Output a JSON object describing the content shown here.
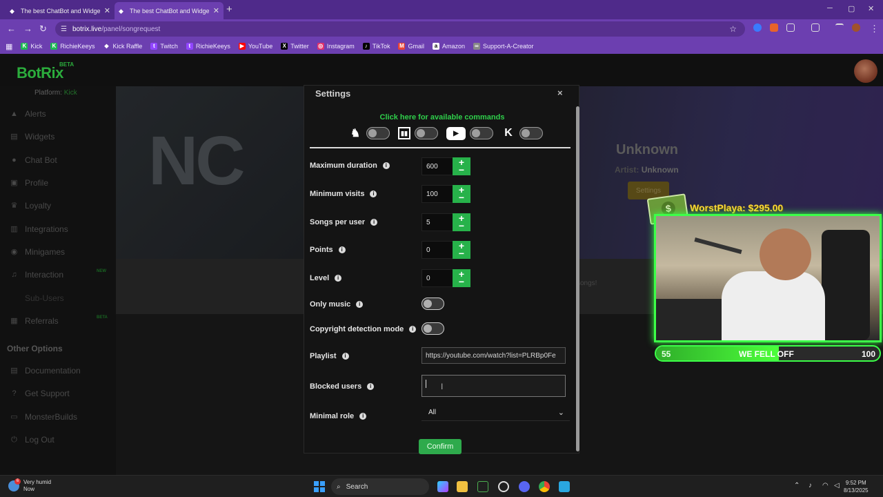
{
  "browser": {
    "tabs": [
      {
        "title": "The best ChatBot and Widgets",
        "active": false
      },
      {
        "title": "The best ChatBot and Widgets",
        "active": true
      }
    ],
    "url_host": "botrix.live",
    "url_path": "/panel/songrequest",
    "bookmarks": [
      {
        "label": "Kick",
        "icon": "kick-icon",
        "color": "#1db954"
      },
      {
        "label": "RichieKeeys",
        "icon": "kick-icon",
        "color": "#1db954"
      },
      {
        "label": "Kick Raffle",
        "icon": "diamond-icon",
        "color": "#ffffff"
      },
      {
        "label": "Twitch",
        "icon": "twitch-icon",
        "color": "#9146ff"
      },
      {
        "label": "RichieKeeys",
        "icon": "twitch-icon",
        "color": "#9146ff"
      },
      {
        "label": "YouTube",
        "icon": "youtube-icon",
        "color": "#ff0000"
      },
      {
        "label": "Twitter",
        "icon": "x-icon",
        "color": "#000000"
      },
      {
        "label": "Instagram",
        "icon": "instagram-icon",
        "color": "#e1306c"
      },
      {
        "label": "TikTok",
        "icon": "tiktok-icon",
        "color": "#000000"
      },
      {
        "label": "Gmail",
        "icon": "gmail-icon",
        "color": "#ea4335"
      },
      {
        "label": "Amazon",
        "icon": "amazon-icon",
        "color": "#ffffff"
      },
      {
        "label": "Support-A-Creator",
        "icon": "link-icon",
        "color": "#888888"
      }
    ]
  },
  "app": {
    "logo": "BotRix",
    "beta": "BETA",
    "platform_label": "Platform:",
    "platform_value": "Kick",
    "sidebar": [
      {
        "label": "Alerts",
        "icon": "alert-icon"
      },
      {
        "label": "Widgets",
        "icon": "widgets-icon"
      },
      {
        "label": "Chat Bot",
        "icon": "chat-icon"
      },
      {
        "label": "Profile",
        "icon": "profile-icon"
      },
      {
        "label": "Loyalty",
        "icon": "trophy-icon"
      },
      {
        "label": "Integrations",
        "icon": "integrations-icon"
      },
      {
        "label": "Minigames",
        "icon": "gamepad-icon"
      },
      {
        "label": "Interaction",
        "icon": "music-icon",
        "badge": "NEW"
      },
      {
        "label": "Sub-Users",
        "icon": "users-icon"
      },
      {
        "label": "Referrals",
        "icon": "referrals-icon",
        "badge": "BETA"
      }
    ],
    "other_options_title": "Other Options",
    "other_options": [
      {
        "label": "Documentation",
        "icon": "document-icon"
      },
      {
        "label": "Get Support",
        "icon": "support-icon"
      },
      {
        "label": "MonsterBuilds",
        "icon": "monitor-icon"
      },
      {
        "label": "Log Out",
        "icon": "logout-icon"
      }
    ],
    "hero_text": "NC",
    "now_playing": {
      "title": "Unknown",
      "artist_label": "Artist:",
      "artist": "Unknown",
      "settings_button": "Settings"
    },
    "songs_text": "songs!"
  },
  "overlay": {
    "donation": "WorstPlaya: $295.00",
    "goal_start": "55",
    "goal_label": "WE FELL OFF",
    "goal_end": "100",
    "goal_progress": 0.55
  },
  "modal": {
    "title": "Settings",
    "close": "×",
    "commands_link": "Click here for available commands",
    "platform_toggles": [
      {
        "icon": "kick-icon",
        "enabled": false
      },
      {
        "icon": "twitch-icon",
        "enabled": false
      },
      {
        "icon": "youtube-icon",
        "enabled": false
      },
      {
        "icon": "kick-k-icon",
        "enabled": false
      }
    ],
    "fields": {
      "max_duration": {
        "label": "Maximum duration",
        "value": "600"
      },
      "min_visits": {
        "label": "Minimum visits",
        "value": "100"
      },
      "songs_per_user": {
        "label": "Songs per user",
        "value": "5"
      },
      "points": {
        "label": "Points",
        "value": "0"
      },
      "level": {
        "label": "Level",
        "value": "0"
      },
      "only_music": {
        "label": "Only music",
        "enabled": false
      },
      "copyright_mode": {
        "label": "Copyright detection mode",
        "enabled": false
      },
      "playlist": {
        "label": "Playlist",
        "value": "https://youtube.com/watch?list=PLRBp0Fe"
      },
      "blocked_users": {
        "label": "Blocked users",
        "value": ""
      },
      "minimal_role": {
        "label": "Minimal role",
        "value": "All"
      }
    },
    "confirm": "Confirm"
  },
  "taskbar": {
    "weather_line1": "Very humid",
    "weather_line2": "Now",
    "weather_badge": "6",
    "search_label": "Search",
    "time": "9:52 PM",
    "date": "8/13/2025"
  },
  "colors": {
    "brand_green": "#35d24a",
    "accent_green_button": "#27b24a",
    "browser_purple": "#6c3fb0"
  }
}
